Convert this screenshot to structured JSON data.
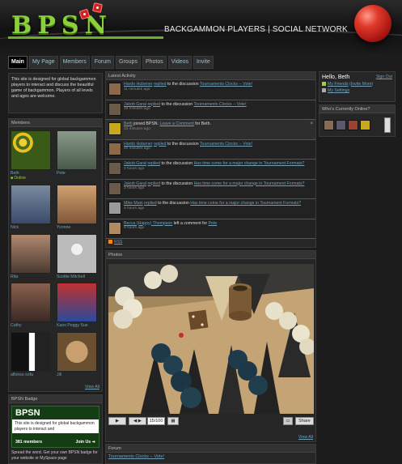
{
  "brand": {
    "logo": "BPSN",
    "tagline": "BACKGAMMON PLAYERS | SOCIAL NETWORK",
    "accent": "#8ccf3c"
  },
  "nav": [
    "Main",
    "My Page",
    "Members",
    "Forum",
    "Groups",
    "Photos",
    "Videos",
    "Invite"
  ],
  "intro": "This site is designed for global backgammon players to interact and discuss the beautiful game of backgammon. Players of all levels and ages are welcome.",
  "members": {
    "title": "Members",
    "online_label": "Online",
    "view_all": "View All",
    "list": [
      {
        "name": "Beth",
        "color": "#c8a81c"
      },
      {
        "name": "Pete",
        "color": "#6a8a6a"
      },
      {
        "name": "Nick",
        "color": "#5a6a8a"
      },
      {
        "name": "Yvonne",
        "color": "#a07850"
      },
      {
        "name": "Rita",
        "color": "#8a6a58"
      },
      {
        "name": "Scottie Mitchell",
        "color": "#9a9a9a"
      },
      {
        "name": "Cathy",
        "color": "#6a4a40"
      },
      {
        "name": "Kaos Peggy Sue",
        "color": "#3a5aa0"
      },
      {
        "name": "alfonso sofa",
        "color": "#303030"
      },
      {
        "name": "Jill",
        "color": "#a88860"
      }
    ]
  },
  "badge": {
    "title": "BPSN Badge",
    "name": "BPSN",
    "desc": "This site is designed for global backgammon players to interact and",
    "count": "381 members",
    "join": "Join Us",
    "spread": "Spread the word. Get your own BPSN badge for your website or MySpace page"
  },
  "activity": {
    "title": "Latest Activity",
    "items": [
      {
        "user": "Hardo Hubener",
        "verb": "replied",
        "mid": "to the discussion",
        "link": "Tournaments Clocks -- Vote!",
        "time": "11 minutes ago",
        "hl": false
      },
      {
        "user": "Jakob Garal",
        "verb": "replied",
        "mid": "to the discussion",
        "link": "Tournaments Clocks -- Vote!",
        "time": "16 minutes ago",
        "hl": false
      },
      {
        "user": "Beth",
        "verb": "",
        "mid": "joined BPSN.",
        "link": "Leave a Comment",
        "tail": "for Beth.",
        "time": "33 minutes ago",
        "hl": true
      },
      {
        "user": "Hardo Hubener",
        "verb": "replied",
        "mid": "to the discussion",
        "link": "Tournaments Clocks -- Vote!",
        "time": "40 minutes ago",
        "hl": false
      },
      {
        "user": "Jakob Garal",
        "verb": "replied",
        "mid": "to the discussion",
        "link": "Has time come for a major change in Tournament Formats?",
        "time": "2 hours ago",
        "hl": false
      },
      {
        "user": "Jakob Garal",
        "verb": "replied",
        "mid": "to the discussion",
        "link": "Has time come for a major change in Tournament Formats?",
        "time": "3 hours ago",
        "hl": false
      },
      {
        "user": "Mike Main",
        "verb": "replied",
        "mid": "to the discussion",
        "link": "Has time come for a major change in Tournament Formats?",
        "time": "4 hours ago",
        "hl": false
      },
      {
        "user": "Becca (Happy) Thompson",
        "verb": "",
        "mid": "left a comment for",
        "link": "Pete",
        "time": "8 hours ago",
        "hl": false
      }
    ],
    "rss": "RSS"
  },
  "photos": {
    "title": "Photos",
    "counter": "15/100",
    "share": "Share",
    "view_all": "View All"
  },
  "forum": {
    "title": "Forum",
    "first": "Tournaments Clocks -- Vote!"
  },
  "hello": {
    "title": "Hello, Beth",
    "sign_out": "Sign Out",
    "friends": "My Friends",
    "invite": "Invite More",
    "settings": "My Settings"
  },
  "online_panel": {
    "title": "Who's Currently Online?"
  }
}
